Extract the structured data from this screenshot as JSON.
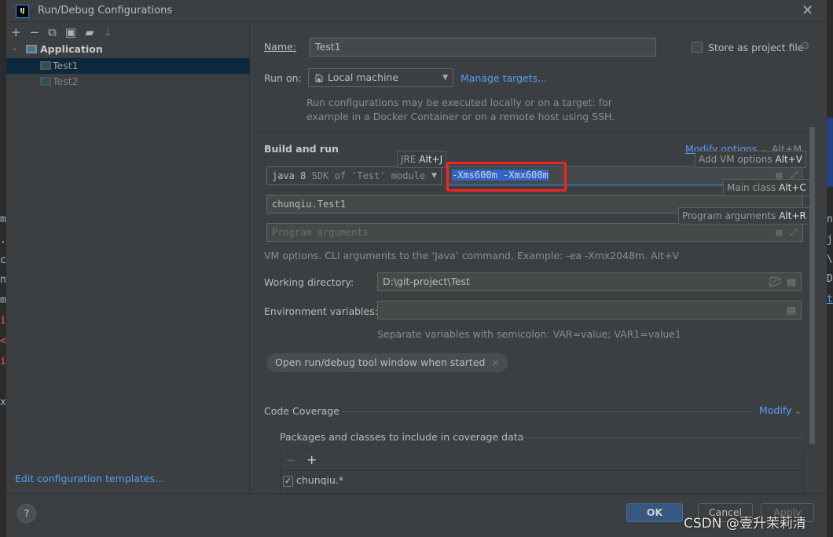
{
  "window": {
    "title": "Run/Debug Configurations",
    "logo": "IJ"
  },
  "toolbar": {
    "icons": [
      "add-icon",
      "remove-icon",
      "copy-icon",
      "save-icon",
      "new-folder-icon",
      "sort-icon"
    ]
  },
  "tree": {
    "group": "Application",
    "items": [
      {
        "label": "Test1",
        "selected": true
      },
      {
        "label": "Test2",
        "selected": false
      }
    ]
  },
  "sidebar": {
    "edit_templates": "Edit configuration templates..."
  },
  "form": {
    "name_label": "Name:",
    "name_value": "Test1",
    "store_label": "Store as project file",
    "store_checked": false,
    "run_on_label": "Run on:",
    "run_on_value": "Local machine",
    "manage_targets": "Manage targets...",
    "run_on_hint_1": "Run configurations may be executed locally or on a target: for",
    "run_on_hint_2": "example in a Docker Container or on a remote host using SSH.",
    "build_and_run": "Build and run",
    "modify_options": "Modify options",
    "modify_shortcut": "Alt+M",
    "jre_value": "java 8",
    "jre_hint": "SDK of 'Test' module",
    "vm_options": "-Xms600m -Xmx600m",
    "main_class": "chunqiu.Test1",
    "program_args_placeholder": "Program arguments",
    "vm_hint": "VM options. CLI arguments to the ‘Java’ command. Example: -ea -Xmx2048m. Alt+V",
    "working_dir_label": "Working directory:",
    "working_dir_value": "D:\\git-project\\Test",
    "env_label": "Environment variables:",
    "env_value": "",
    "env_hint": "Separate variables with semicolon: VAR=value; VAR1=value1",
    "chip": "Open run/debug tool window when started",
    "code_coverage": "Code Coverage",
    "modify": "Modify",
    "packages_label": "Packages and classes to include in coverage data",
    "package_item": "chunqiu.*",
    "package_checked": true
  },
  "tooltips": {
    "jre": {
      "text": "JRE",
      "key": "Alt+J"
    },
    "vm": {
      "text": "Add VM options",
      "key": "Alt+V"
    },
    "main": {
      "text": "Main class",
      "key": "Alt+C"
    },
    "args": {
      "text": "Program arguments",
      "key": "Alt+R"
    }
  },
  "buttons": {
    "ok": "OK",
    "cancel": "Cancel",
    "apply": "Apply",
    "help": "?"
  },
  "watermark": "CSDN @壹升茉莉清",
  "background_code": {
    "left": [
      "m",
      ".",
      "c",
      "n",
      "m",
      "i",
      "<",
      "i",
      "x"
    ],
    "right": [
      "n",
      "j",
      "\\",
      "D",
      "t"
    ]
  },
  "colors": {
    "accent": "#589df6",
    "selection": "#0d293e",
    "ok": "#365880",
    "highlight": "#ff2020",
    "text_selection": "#2f65ca"
  }
}
